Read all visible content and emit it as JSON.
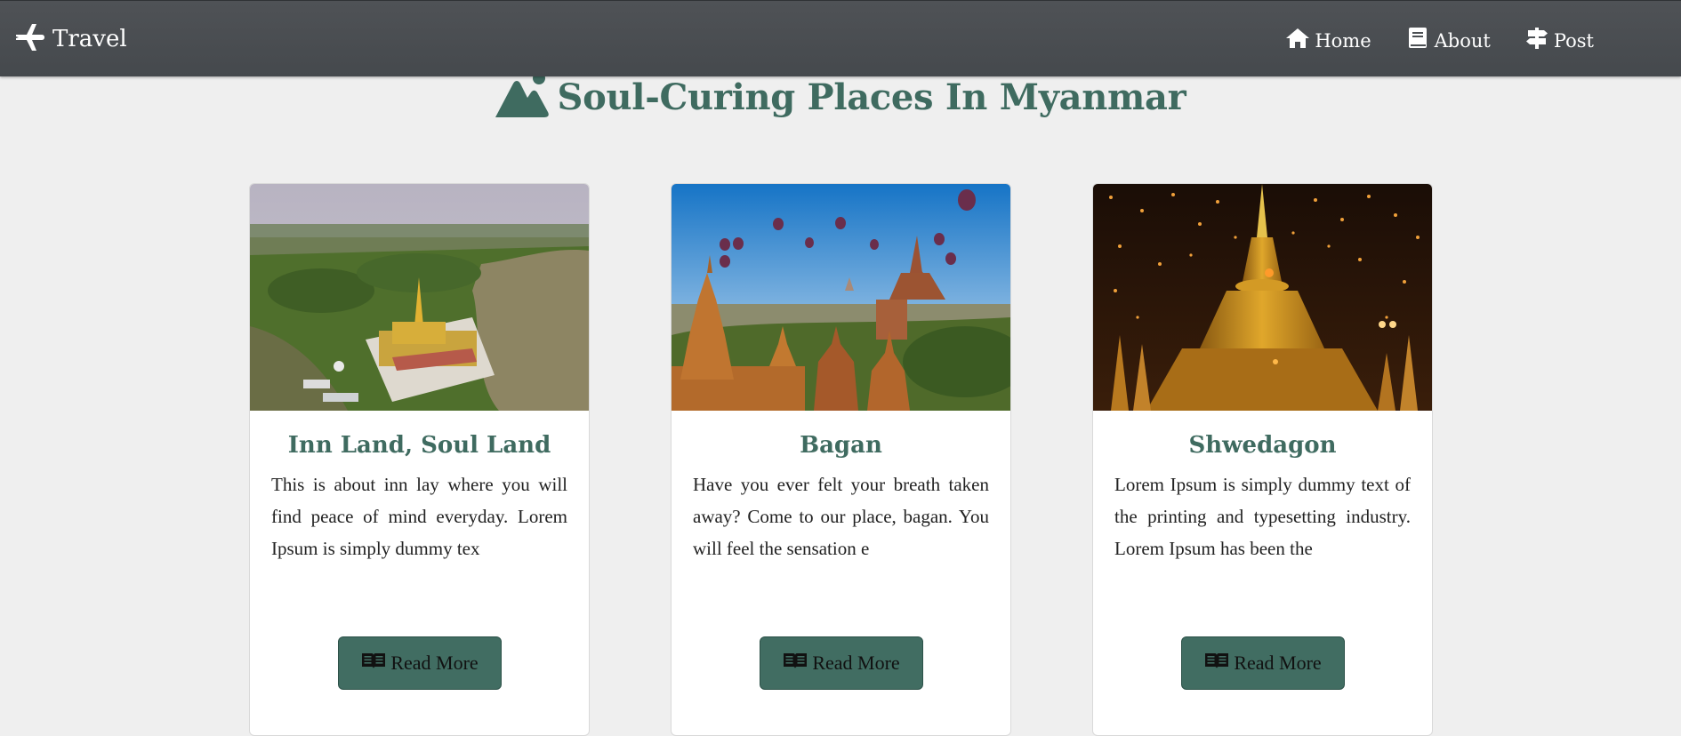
{
  "navbar": {
    "brand": {
      "label": "Travel",
      "icon": "plane-icon"
    },
    "links": [
      {
        "label": "Home",
        "icon": "home-icon"
      },
      {
        "label": "About",
        "icon": "book-icon"
      },
      {
        "label": "Post",
        "icon": "signpost-icon"
      }
    ]
  },
  "heading": {
    "icon": "mountain-icon",
    "title": "Soul-Curing Places In Myanmar"
  },
  "cards": [
    {
      "title": "Inn Land, Soul Land",
      "text": "This is about inn lay where you will find peace of mind everyday. Lorem Ipsum is simply dummy tex",
      "button_label": "Read More",
      "button_icon": "book-open-icon"
    },
    {
      "title": "Bagan",
      "text": "Have you ever felt your breath taken away? Come to our place, bagan. You will feel the sensation e",
      "button_label": "Read More",
      "button_icon": "book-open-icon"
    },
    {
      "title": "Shwedagon",
      "text": "Lorem Ipsum is simply dummy text of the printing and typesetting industry. Lorem Ipsum has been the",
      "button_label": "Read More",
      "button_icon": "book-open-icon"
    }
  ],
  "colors": {
    "navbar_bg": "#4b4f53",
    "accent": "#3f6b60",
    "page_bg": "#efefef",
    "button_bg": "#416d62"
  }
}
